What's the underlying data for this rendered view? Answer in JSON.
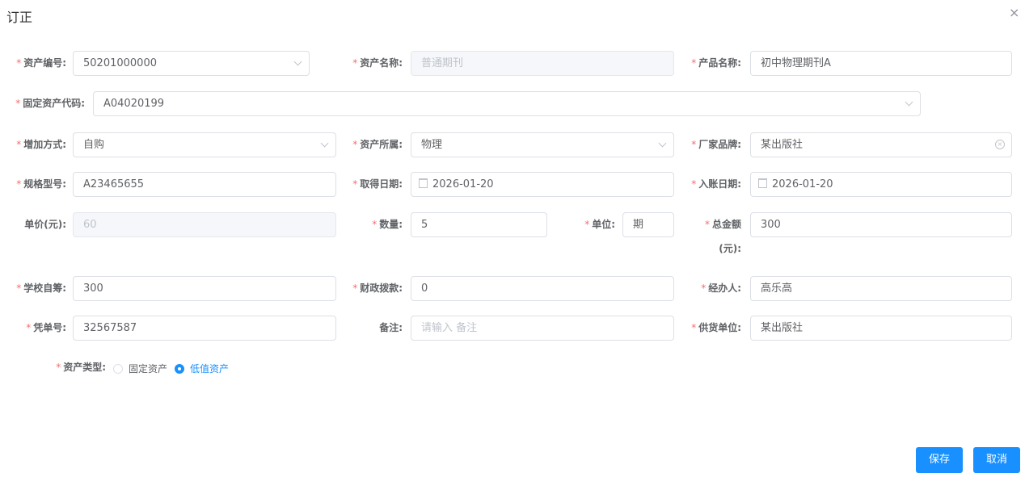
{
  "dialog": {
    "title": "订正",
    "close": "×"
  },
  "fields": [
    {
      "label": "资产编号:",
      "value": "50201000000",
      "required": true,
      "type": "select"
    },
    {
      "label": "资产名称:",
      "value": "普通期刊",
      "required": true,
      "type": "disabled"
    },
    {
      "label": "产品名称:",
      "value": "初中物理期刊A",
      "required": true,
      "type": "text"
    },
    {
      "label": "固定资产代码:",
      "value": "A04020199",
      "required": true,
      "type": "select"
    },
    {
      "label": "增加方式:",
      "value": "自购",
      "required": true,
      "type": "select"
    },
    {
      "label": "资产所属:",
      "value": "物理",
      "required": true,
      "type": "select"
    },
    {
      "label": "厂家品牌:",
      "value": "某出版社",
      "required": true,
      "type": "clearable"
    },
    {
      "label": "规格型号:",
      "value": "A23465655",
      "required": true,
      "type": "text"
    },
    {
      "label": "取得日期:",
      "value": "2026-01-20",
      "required": true,
      "type": "date"
    },
    {
      "label": "入账日期:",
      "value": "2026-01-20",
      "required": true,
      "type": "date"
    },
    {
      "label": "单价(元):",
      "value": "60",
      "required": false,
      "type": "disabled"
    },
    {
      "label": "数量:",
      "value": "5",
      "required": true,
      "type": "text"
    },
    {
      "label": "单位:",
      "value": "期",
      "required": true,
      "type": "text"
    },
    {
      "label": "总金额",
      "label2": "(元):",
      "value": "300",
      "required": true,
      "type": "text"
    },
    {
      "label": "学校自筹:",
      "value": "300",
      "required": true,
      "type": "text"
    },
    {
      "label": "财政拨款:",
      "value": "0",
      "required": true,
      "type": "text"
    },
    {
      "label": "经办人:",
      "value": "高乐高",
      "required": true,
      "type": "text"
    },
    {
      "label": "凭单号:",
      "value": "32567587",
      "required": true,
      "type": "text"
    },
    {
      "label": "备注:",
      "value": "",
      "placeholder": "请输入 备注",
      "required": false,
      "type": "text"
    },
    {
      "label": "供货单位:",
      "value": "某出版社",
      "required": true,
      "type": "text"
    }
  ],
  "asset_type": {
    "label": "资产类型:",
    "options": [
      "固定资产",
      "低值资产"
    ],
    "selected": 1
  },
  "buttons": {
    "save": "保存",
    "cancel": "取消"
  },
  "colors": {
    "primary": "#1890ff",
    "required": "#f56c6c"
  }
}
